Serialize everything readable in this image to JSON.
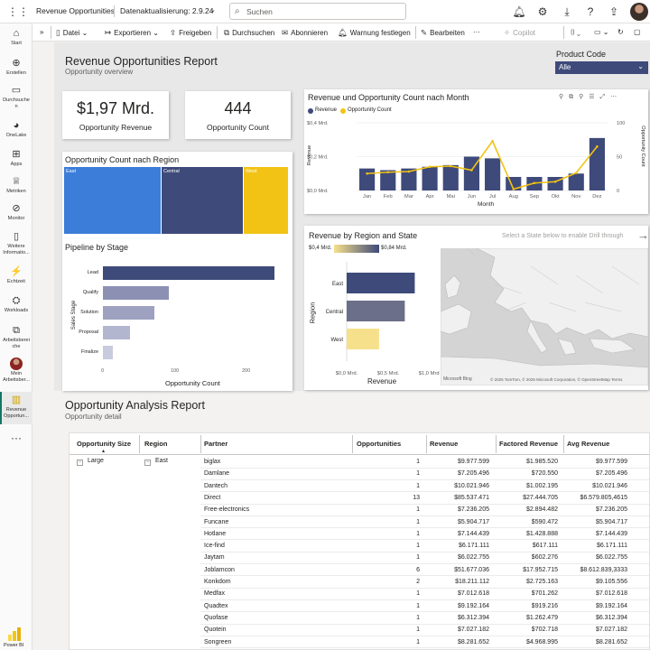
{
  "topbar": {
    "app_title": "Revenue Opportunities",
    "refresh": "Datenaktualisierung: 2.9.24",
    "search_placeholder": "Suchen"
  },
  "leftrail": [
    {
      "label": "Start",
      "icon": "home-icon"
    },
    {
      "label": "Erstellen",
      "icon": "create-icon"
    },
    {
      "label": "Durchsuchen",
      "icon": "folder-icon"
    },
    {
      "label": "OneLake",
      "icon": "onelake-icon"
    },
    {
      "label": "Apps",
      "icon": "apps-icon"
    },
    {
      "label": "Metriken",
      "icon": "metrics-icon"
    },
    {
      "label": "Monitor",
      "icon": "monitor-icon"
    },
    {
      "label": "Weitere Informatio...",
      "icon": "learn-icon"
    },
    {
      "label": "Echtzeit",
      "icon": "realtime-icon"
    },
    {
      "label": "Workloads",
      "icon": "workloads-icon"
    },
    {
      "label": "Arbeitsbereiche",
      "icon": "workspaces-icon"
    },
    {
      "label": "Mein Arbeitsber...",
      "icon": "my-workspace-icon"
    },
    {
      "label": "Revenue Opportun...",
      "icon": "report-icon"
    }
  ],
  "brand": "Power BI",
  "cmdbar": {
    "file": "Datei",
    "export": "Exportieren",
    "share": "Freigeben",
    "search": "Durchsuchen",
    "subscribe": "Abonnieren",
    "alert": "Warnung festlegen",
    "edit": "Bearbeiten",
    "copilot": "Copilot"
  },
  "report": {
    "title": "Revenue Opportunities Report",
    "subtitle": "Opportunity overview"
  },
  "filter": {
    "label": "Product Code",
    "value": "Alle"
  },
  "kpis": {
    "revenue_value": "$1,97 Mrd.",
    "revenue_label": "Opportunity Revenue",
    "count_value": "444",
    "count_label": "Opportunity Count"
  },
  "treemap": {
    "title": "Opportunity Count nach Region",
    "regions": [
      {
        "name": "East",
        "share": 0.41,
        "color": "#3b7dd8"
      },
      {
        "name": "Central",
        "share": 0.37,
        "color": "#3e4a7a"
      },
      {
        "name": "West",
        "share": 0.22,
        "color": "#f2c314"
      }
    ]
  },
  "funnel": {
    "title": "Pipeline by Stage",
    "axis_title": "Sales Stage",
    "xlabel": "Opportunity Count",
    "ticks": [
      "0",
      "100",
      "200"
    ],
    "stages": [
      {
        "name": "Lead",
        "value": 242,
        "color": "#3e4a7a"
      },
      {
        "name": "Qualify",
        "value": 93,
        "color": "#8c91b4"
      },
      {
        "name": "Solution",
        "value": 73,
        "color": "#9ea2c0"
      },
      {
        "name": "Proposal",
        "value": 38,
        "color": "#b3b6cf"
      },
      {
        "name": "Finalize",
        "value": 14,
        "color": "#c8cadd"
      }
    ]
  },
  "combo": {
    "title": "Revenue und Opportunity Count nach Month",
    "legend_revenue": "Revenue",
    "legend_count": "Opportunity Count",
    "ylabel_left": "Revenue",
    "ylabel_right": "Opportunity Count",
    "xlabel": "Month",
    "left_ticks": [
      "$0,4 Mrd.",
      "$0,2 Mrd.",
      "$0,0 Mrd."
    ],
    "right_ticks": [
      "100",
      "50",
      "0"
    ],
    "revenue_color": "#3e4a7a",
    "count_color": "#f2c314"
  },
  "chart_data": [
    {
      "type": "bar",
      "title": "Revenue und Opportunity Count nach Month",
      "categories": [
        "Jan",
        "Feb",
        "Mar",
        "Apr",
        "Mai",
        "Jun",
        "Jul",
        "Aug",
        "Sep",
        "Okt",
        "Nov",
        "Dez"
      ],
      "series": [
        {
          "name": "Revenue",
          "values": [
            0.13,
            0.12,
            0.13,
            0.14,
            0.15,
            0.2,
            0.19,
            0.08,
            0.08,
            0.08,
            0.1,
            0.31
          ]
        },
        {
          "name": "Opportunity Count",
          "values": [
            25,
            27,
            28,
            35,
            36,
            30,
            73,
            2,
            11,
            13,
            26,
            65
          ]
        }
      ],
      "xlabel": "Month",
      "ylabel": "Revenue",
      "ylim": [
        0,
        0.4
      ],
      "y2label": "Opportunity Count",
      "y2lim": [
        0,
        100
      ]
    },
    {
      "type": "bar",
      "title": "Revenue by Region and State",
      "categories": [
        "East",
        "Central",
        "West"
      ],
      "values": [
        0.82,
        0.7,
        0.39
      ],
      "xlabel": "Revenue",
      "ylabel": "Region",
      "xlim": [
        0,
        1.0
      ]
    }
  ],
  "region_bars": {
    "title": "Revenue by Region and State",
    "gradient_min": "$0,4 Mrd.",
    "gradient_max": "$0,84 Mrd.",
    "ylabel": "Region",
    "xlabel": "Revenue",
    "ticks": [
      "$0,0 Mrd.",
      "$0,5 Mrd.",
      "$1,0 Mrd."
    ],
    "hint": "Select a State below to enable Drill through",
    "colors": [
      "#3e4a7a",
      "#6c6f8a",
      "#f6e08b"
    ]
  },
  "map": {
    "brand": "Microsoft Bing",
    "attribution": "© 2025 TomTom, © 2025 Microsoft Corporation, © OpenStreetMap Terms"
  },
  "analysis": {
    "title": "Opportunity Analysis Report",
    "subtitle": "Opportunity detail",
    "headers": [
      "Opportunity Size",
      "Region",
      "Partner",
      "Opportunities",
      "Revenue",
      "Factored Revenue",
      "Avg Revenue"
    ],
    "size": "Large",
    "region": "East",
    "rows": [
      [
        "biglax",
        "1",
        "$9.977.599",
        "$1.985.520",
        "$9.977.599"
      ],
      [
        "Damlane",
        "1",
        "$7.205.496",
        "$720.550",
        "$7.205.496"
      ],
      [
        "Dantech",
        "1",
        "$10.021.946",
        "$1.002.195",
        "$10.021.946"
      ],
      [
        "Direct",
        "13",
        "$85.537.471",
        "$27.444.705",
        "$6.579.805,4615"
      ],
      [
        "Free-electronics",
        "1",
        "$7.236.205",
        "$2.894.482",
        "$7.236.205"
      ],
      [
        "Funcane",
        "1",
        "$5.904.717",
        "$590.472",
        "$5.904.717"
      ],
      [
        "Hotlane",
        "1",
        "$7.144.439",
        "$1.428.888",
        "$7.144.439"
      ],
      [
        "Ice-find",
        "1",
        "$6.171.111",
        "$617.111",
        "$6.171.111"
      ],
      [
        "Jaytam",
        "1",
        "$6.022.755",
        "$602.276",
        "$6.022.755"
      ],
      [
        "Joblamcon",
        "6",
        "$51.677.036",
        "$17.952.715",
        "$8.612.839,3333"
      ],
      [
        "Konkdom",
        "2",
        "$18.211.112",
        "$2.725.163",
        "$9.105.556"
      ],
      [
        "Medfax",
        "1",
        "$7.012.618",
        "$701.262",
        "$7.012.618"
      ],
      [
        "Quadtex",
        "1",
        "$9.192.164",
        "$919.216",
        "$9.192.164"
      ],
      [
        "Quofase",
        "1",
        "$6.312.394",
        "$1.262.479",
        "$6.312.394"
      ],
      [
        "Quotein",
        "1",
        "$7.027.182",
        "$702.718",
        "$7.027.182"
      ],
      [
        "Songreen",
        "1",
        "$8.281.652",
        "$4.968.995",
        "$8.281.652"
      ]
    ]
  }
}
